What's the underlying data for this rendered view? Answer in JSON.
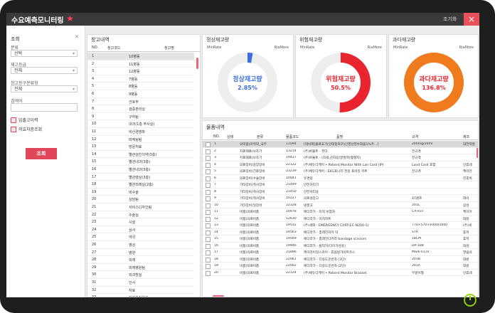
{
  "app": {
    "title": "수요예측모니터링",
    "settings_label": "조기화",
    "close_label": "×"
  },
  "left": {
    "title": "조회",
    "close_label": "✕",
    "fields": [
      {
        "label": "분류",
        "value": "선택"
      },
      {
        "label": "재고등급",
        "value": "전체"
      },
      {
        "label": "창고등구분류항",
        "value": "전체"
      }
    ],
    "search_label": "검색어",
    "search_value": "",
    "checks": [
      {
        "label": "입출고이력"
      },
      {
        "label": "저효자증조회"
      }
    ],
    "search_button": "조회"
  },
  "warehouse": {
    "title": "창고내역",
    "headers": [
      "NO.",
      "창고코드",
      "창고명"
    ],
    "rows": [
      [
        "1",
        "10병동"
      ],
      [
        "2",
        "11병동"
      ],
      [
        "3",
        "12병동"
      ],
      [
        "4",
        "7병동"
      ],
      [
        "5",
        "8병동"
      ],
      [
        "6",
        "9병동"
      ],
      [
        "7",
        "건호부"
      ],
      [
        "8",
        "검증판리실"
      ],
      [
        "9",
        "구하팀"
      ],
      [
        "10",
        "내과(1층 주사실)"
      ],
      [
        "11",
        "비산경영파"
      ],
      [
        "12",
        "마케팅팀"
      ],
      [
        "13",
        "방문처료"
      ],
      [
        "14",
        "별관검진의약(3층)"
      ],
      [
        "15",
        "별관내과(3층)"
      ],
      [
        "16",
        "별관내과(3층)"
      ],
      [
        "17",
        "별관영상(3층)"
      ],
      [
        "18",
        "별관외래실(2층)"
      ],
      [
        "19",
        "비수술"
      ],
      [
        "20",
        "상담팀"
      ],
      [
        "21",
        "서비스디자인팀"
      ],
      [
        "22",
        "수술실"
      ],
      [
        "23",
        "시설"
      ],
      [
        "24",
        "심사"
      ],
      [
        "25",
        "약국"
      ],
      [
        "26",
        "영상"
      ],
      [
        "27",
        "영양"
      ],
      [
        "28",
        "외래"
      ],
      [
        "29",
        "외래병원팀"
      ],
      [
        "30",
        "외과방실"
      ],
      [
        "31",
        "인사"
      ],
      [
        "32",
        "자료"
      ],
      [
        "33",
        "전략추진본부"
      ]
    ]
  },
  "gauges": [
    {
      "title": "정상재고량",
      "min_label": "MinRate",
      "max_label": "RiaMore",
      "center": "정상재고량",
      "value_text": "2.85%",
      "value": 2.85,
      "color": "#3b6fe0",
      "text_color": "#3b6fe0"
    },
    {
      "title": "위험재고량",
      "min_label": "MinRate",
      "max_label": "RiaMore",
      "center": "위험재고량",
      "value_text": "50.5%",
      "value": 50.5,
      "color": "#e8252f",
      "text_color": "#e8252f"
    },
    {
      "title": "과다재고량",
      "min_label": "MinRate",
      "max_label": "RiaMore",
      "center": "과다재고량",
      "value_text": "136.8%",
      "value": 136.8,
      "color": "#f07a1e",
      "text_color": "#e8252f"
    }
  ],
  "stock": {
    "title": "물품내역",
    "headers": [
      "NO.",
      "상태",
      "분류",
      "물품코드",
      "품명",
      "규격",
      "제조"
    ],
    "rows": [
      [
        "1",
        "의약품(마취약_국부",
        "11094",
        "[대비제]볼료효기(인데합외코)인영산영수화을1%주...]",
        "200mg/20ml",
        "대한약품"
      ],
      [
        "2",
        "치료재료(보조기",
        "13214",
        "(주)바울트 - 퓨타",
        "전규격",
        ""
      ],
      [
        "3",
        "치료재료(보조기",
        "19437",
        "(주)바울트 - (자세,산자용)말발목(짧절지)",
        "전규격",
        ""
      ],
      [
        "4",
        "의료장비(중앙장비",
        "22122",
        "(주)에듀디케어 • Patient Monitor With Lan Card (IP)",
        "Land Card 포함",
        "인휴네"
      ],
      [
        "5",
        "의료장비(진료장비",
        "23239",
        "(주)에듀디케어 - EKG포니터 전용 포비일 카트",
        "전규격",
        "케이언"
      ],
      [
        "6",
        "의료장비(수술장비",
        "10041",
        "유경링",
        "",
        "진휴위"
      ],
      [
        "7",
        "기타장비(취사장비",
        "21449",
        "안전처리기",
        "",
        ""
      ],
      [
        "8",
        "기타장비(취사장비",
        "21450",
        "안전처리용",
        "",
        ""
      ],
      [
        "9",
        "기타장비(취사장비",
        "10227",
        "의료설장고",
        "47퀀트",
        "화이"
      ],
      [
        "10",
        "기타장비(일장비",
        "22328",
        "냉풍고",
        "201L",
        "삼성"
      ],
      [
        "11",
        "비품(의료비품",
        "10978",
        "에디라가 - 미적 보험자",
        "CA-937",
        "케이아"
      ],
      [
        "12",
        "비품(의료비품",
        "12630",
        "에디라가 - 처치카트",
        "",
        "대원"
      ],
      [
        "13",
        "비품(의료비품",
        "19532",
        "(주)세화 - EMERGENCY CART(EC-N200-1)",
        "770×570×1000/1600",
        "(주)세"
      ],
      [
        "14",
        "비품(의료비품",
        "19563",
        "에디라가 - 총래진처카 턱",
        "STR",
        "휴저"
      ],
      [
        "15",
        "비품(의료비품",
        "19569",
        "에디라가 - 총래진다카라 bandage scissors",
        "18CM",
        "휴저"
      ],
      [
        "16",
        "비품(의료비품",
        "19946",
        "에디라가 - 탈억거(다이가성용)",
        "DP-108",
        "대성"
      ],
      [
        "17",
        "비품(의료비품",
        "21896",
        "케이라이일스커어 - 휴림방가미트코스",
        "Mark-II,L/V",
        "영림의"
      ],
      [
        "18",
        "비품(의료비품",
        "22061",
        "에디라가 - 다용도운반자 (3단)",
        "201B",
        "대원"
      ],
      [
        "19",
        "비품(의료비품",
        "22062",
        "에디라가 - 다용도운반자 (2단)",
        "201A",
        "대원"
      ],
      [
        "20",
        "비품(의료비품",
        "22124",
        "(주)에듀디케어 • Patient Monitor Bracket",
        "부갈이형",
        "인휴네"
      ]
    ]
  }
}
